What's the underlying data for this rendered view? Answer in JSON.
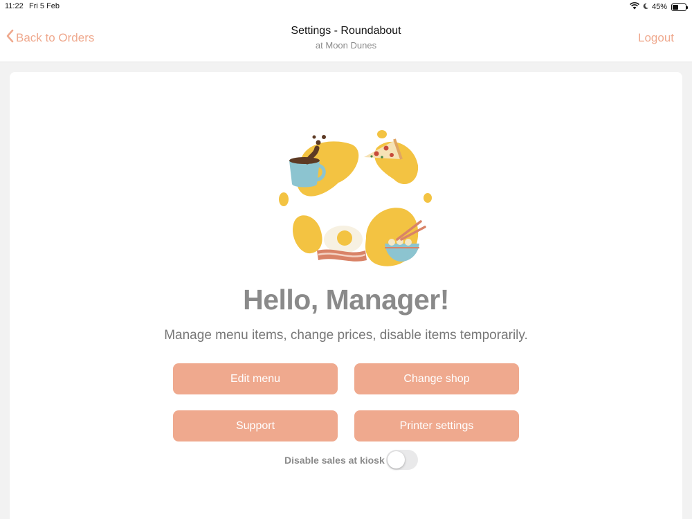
{
  "status_bar": {
    "time": "11:22",
    "date": "Fri 5 Feb",
    "battery_percent": "45%",
    "battery_level": 0.45,
    "icons": [
      "wifi-icon",
      "moon-icon",
      "battery-icon"
    ]
  },
  "nav": {
    "back_label": "Back to Orders",
    "title": "Settings - Roundabout",
    "subtitle": "at Moon Dunes",
    "logout_label": "Logout"
  },
  "main": {
    "greeting": "Hello, Manager!",
    "description": "Manage menu items, change prices, disable items temporarily.",
    "buttons": [
      {
        "label": "Edit menu"
      },
      {
        "label": "Change shop"
      },
      {
        "label": "Support"
      },
      {
        "label": "Printer settings"
      }
    ],
    "toggle": {
      "label": "Disable sales at kiosk",
      "on": false
    }
  },
  "colors": {
    "accent": "#efa98e",
    "text_gray": "#8a8a8a",
    "blob_yellow": "#f3c342"
  }
}
